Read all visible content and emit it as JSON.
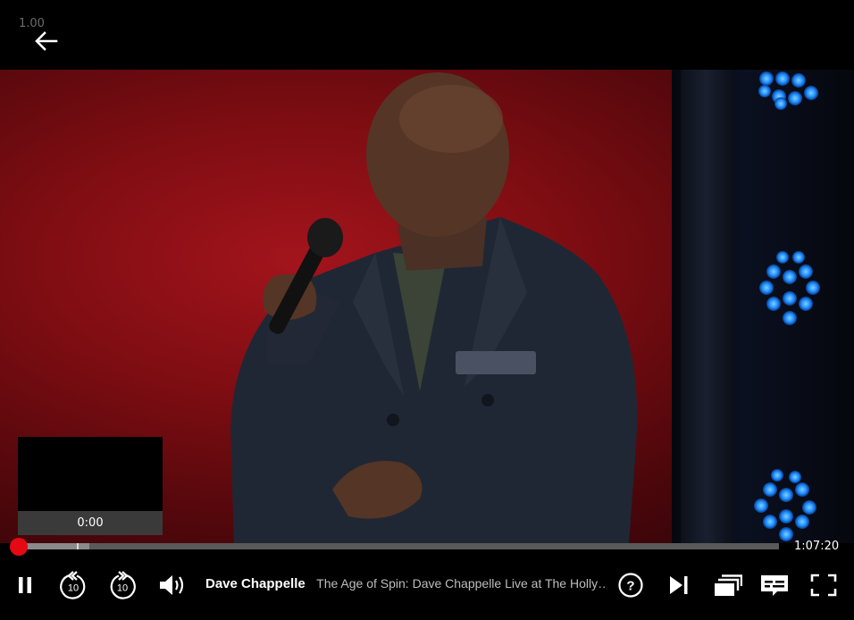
{
  "window": {
    "version": "1.00"
  },
  "player": {
    "thumbnail_time": "0:00",
    "time_remaining": "1:07:20",
    "progress_fraction": 0.0,
    "buffered_fraction": 0.093
  },
  "info": {
    "show_title": "Dave Chappelle",
    "episode_title": "The Age of Spin: Dave Chappelle Live at The Holly…"
  },
  "controls": {
    "skip_back_seconds": "10",
    "skip_forward_seconds": "10"
  },
  "icons": [
    "back-arrow-icon",
    "pause-icon",
    "rewind-10-icon",
    "forward-10-icon",
    "volume-icon",
    "help-icon",
    "next-episode-icon",
    "episodes-icon",
    "subtitles-icon",
    "fullscreen-icon"
  ],
  "colors": {
    "accent": "#e50914",
    "track": "#5a5a5a",
    "background": "#000000"
  }
}
